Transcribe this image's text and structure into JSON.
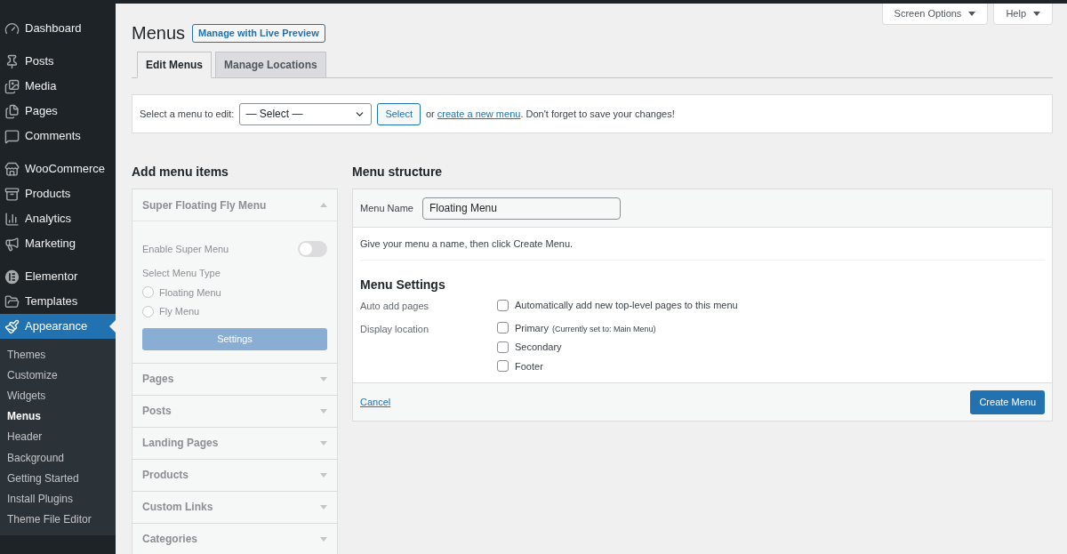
{
  "sidebar": {
    "sections": [
      [
        {
          "label": "Dashboard",
          "selected": false
        }
      ],
      [
        {
          "label": "Posts",
          "selected": false
        },
        {
          "label": "Media",
          "selected": false
        },
        {
          "label": "Pages",
          "selected": false
        },
        {
          "label": "Comments",
          "selected": false
        }
      ],
      [
        {
          "label": "WooCommerce",
          "selected": false
        },
        {
          "label": "Products",
          "selected": false
        },
        {
          "label": "Analytics",
          "selected": false
        },
        {
          "label": "Marketing",
          "selected": false
        }
      ],
      [
        {
          "label": "Elementor",
          "selected": false
        },
        {
          "label": "Templates",
          "selected": false
        },
        {
          "label": "Appearance",
          "selected": true,
          "children": [
            {
              "label": "Themes",
              "selected": false
            },
            {
              "label": "Customize",
              "selected": false
            },
            {
              "label": "Widgets",
              "selected": false
            },
            {
              "label": "Menus",
              "selected": true
            },
            {
              "label": "Header",
              "selected": false
            },
            {
              "label": "Background",
              "selected": false
            },
            {
              "label": "Getting Started",
              "selected": false
            },
            {
              "label": "Install Plugins",
              "selected": false
            },
            {
              "label": "Theme File Editor",
              "selected": false
            }
          ]
        }
      ]
    ]
  },
  "header_buttons": [
    "Screen Options",
    "Help"
  ],
  "page": {
    "title": "Menus",
    "action": "Manage with Live Preview"
  },
  "tabs": [
    {
      "label": "Edit Menus",
      "selected": true
    },
    {
      "label": "Manage Locations",
      "selected": false
    }
  ],
  "select_bar": {
    "label": "Select a menu to edit:",
    "value": "— Select —",
    "button": "Select",
    "before_link": "or",
    "link": "create a new menu",
    "after_link": ". Don't forget to save your changes!"
  },
  "add_items": {
    "title": "Add menu items",
    "sections": [
      {
        "title": "Super Floating Fly Menu",
        "expanded": true,
        "toggle_label": "Enable Super Menu",
        "toggle_on": false,
        "type_label": "Select Menu Type",
        "options": [
          {
            "label": "Floating Menu",
            "selected": false
          },
          {
            "label": "Fly Menu",
            "selected": false
          }
        ],
        "button": "Settings"
      },
      {
        "title": "Pages",
        "expanded": false
      },
      {
        "title": "Posts",
        "expanded": false
      },
      {
        "title": "Landing Pages",
        "expanded": false
      },
      {
        "title": "Products",
        "expanded": false
      },
      {
        "title": "Custom Links",
        "expanded": false
      },
      {
        "title": "Categories",
        "expanded": false
      }
    ]
  },
  "structure": {
    "title": "Menu structure",
    "name_label": "Menu Name",
    "name_value": "Floating Menu",
    "help": "Give your menu a name, then click Create Menu.",
    "settings_title": "Menu Settings",
    "rows": [
      {
        "label": "Auto add pages",
        "options": [
          {
            "label": "Automatically add new top-level pages to this menu",
            "checked": false
          }
        ]
      },
      {
        "label": "Display location",
        "options": [
          {
            "label": "Primary",
            "note": "(Currently set to: Main Menu)",
            "checked": false
          },
          {
            "label": "Secondary",
            "checked": false
          },
          {
            "label": "Footer",
            "checked": false
          }
        ]
      }
    ],
    "cancel": "Cancel",
    "submit": "Create Menu"
  }
}
